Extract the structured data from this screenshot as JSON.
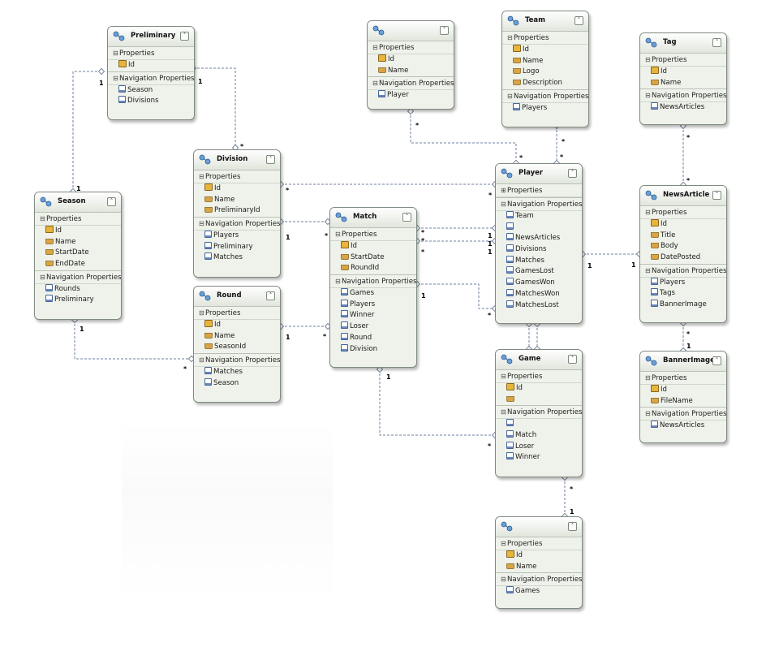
{
  "labels": {
    "properties": "Properties",
    "navigation_properties": "Navigation Properties"
  },
  "entities": {
    "preliminary": {
      "name": "Preliminary",
      "properties": [
        "Id"
      ],
      "navigation": [
        "Season",
        "Divisions"
      ]
    },
    "season": {
      "name": "Season",
      "properties": [
        "Id",
        "Name",
        "StartDate",
        "EndDate"
      ],
      "navigation": [
        "Rounds",
        "Preliminary"
      ]
    },
    "division": {
      "name": "Division",
      "properties": [
        "Id",
        "Name",
        "PreliminaryId"
      ],
      "navigation": [
        "Players",
        "Preliminary",
        "Matches"
      ]
    },
    "round": {
      "name": "Round",
      "properties": [
        "Id",
        "Name",
        "SeasonId"
      ],
      "navigation": [
        "Matches",
        "Season"
      ]
    },
    "match": {
      "name": "Match",
      "properties": [
        "Id",
        "StartDate",
        "RoundId"
      ],
      "navigation": [
        "Games",
        "Players",
        "Winner",
        "Loser",
        "Round",
        "Division"
      ]
    },
    "top_unnamed": {
      "name": "",
      "properties": [
        "Id",
        "Name"
      ],
      "navigation": [
        "Player"
      ]
    },
    "team": {
      "name": "Team",
      "properties": [
        "Id",
        "Name",
        "Logo",
        "Description"
      ],
      "navigation": [
        "Players"
      ]
    },
    "tag": {
      "name": "Tag",
      "properties": [
        "Id",
        "Name"
      ],
      "navigation": [
        "NewsArticles"
      ]
    },
    "player": {
      "name": "Player",
      "properties": [],
      "navigation": [
        "Team",
        "",
        "NewsArticles",
        "Divisions",
        "Matches",
        "GamesLost",
        "GamesWon",
        "MatchesWon",
        "MatchesLost"
      ]
    },
    "news_article": {
      "name": "NewsArticle",
      "properties": [
        "Id",
        "Title",
        "Body",
        "DatePosted"
      ],
      "navigation": [
        "Players",
        "Tags",
        "BannerImage"
      ]
    },
    "game": {
      "name": "Game",
      "properties": [
        "Id",
        ""
      ],
      "navigation": [
        "",
        "Match",
        "Loser",
        "Winner"
      ]
    },
    "banner_image": {
      "name": "BannerImage",
      "properties": [
        "Id",
        "FileName"
      ],
      "navigation": [
        "NewsArticles"
      ]
    },
    "bottom_unnamed": {
      "name": "",
      "properties": [
        "Id",
        "Name"
      ],
      "navigation": [
        "Games"
      ]
    }
  },
  "multiplicities": [
    "1",
    "1",
    "*",
    "1",
    "1",
    "*",
    "1",
    "*",
    "*",
    "*",
    "1",
    "*",
    "*",
    "1",
    "*",
    "1",
    "1",
    "*",
    "1",
    "*",
    "1",
    "*",
    "*",
    "*",
    "*",
    "*",
    "1",
    "1",
    "*",
    "*",
    "*",
    "1",
    "*",
    "1"
  ]
}
